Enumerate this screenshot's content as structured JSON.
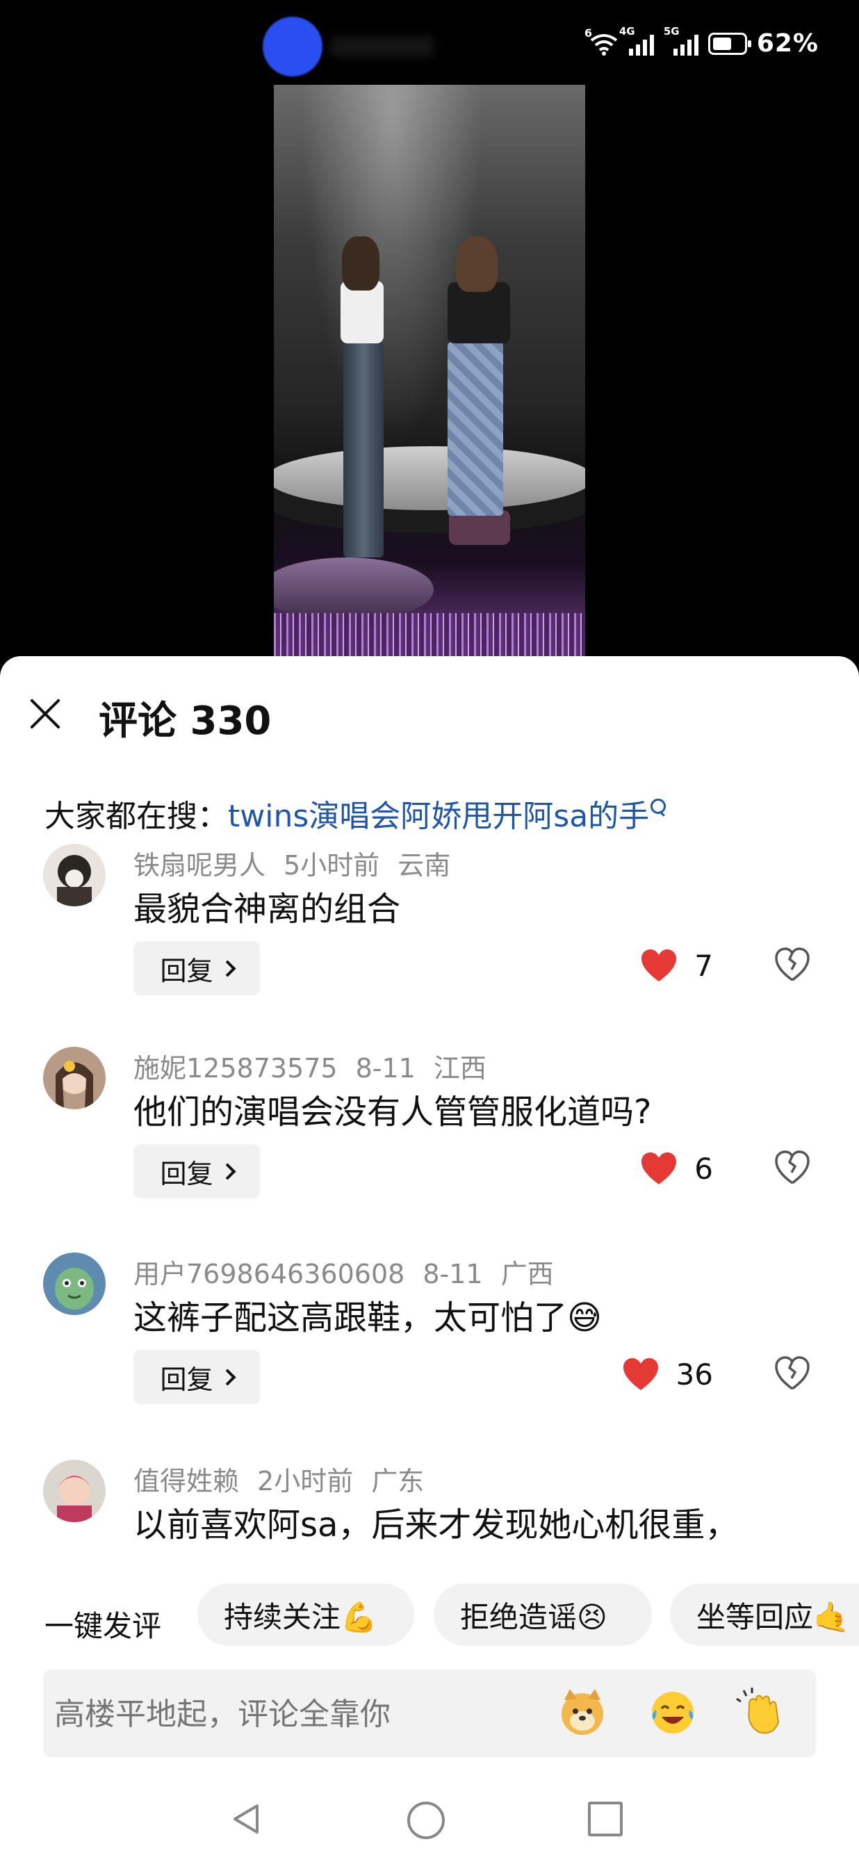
{
  "status_bar": {
    "wifi_badge": "6",
    "sim1_badge": "4G",
    "sim2_badge": "5G",
    "battery_percent": "62%",
    "battery_level": 0.62
  },
  "comments_panel": {
    "title": "评论 330",
    "hot_search_label": "大家都在搜：",
    "hot_search_query": "twins演唱会阿娇甩开阿sa的手",
    "reply_label": "回复",
    "comments": [
      {
        "user": "铁扇呢男人",
        "time": "5小时前",
        "location": "云南",
        "text": "最貌合神离的组合",
        "likes": "7"
      },
      {
        "user": "施妮125873575",
        "time": "8-11",
        "location": "江西",
        "text": "他们的演唱会没有人管管服化道吗?",
        "likes": "6"
      },
      {
        "user": "用户7698646360608",
        "time": "8-11",
        "location": "广西",
        "text": "这裤子配这高跟鞋，太可怕了😅",
        "likes": "36"
      },
      {
        "user": "值得姓赖",
        "time": "2小时前",
        "location": "广东",
        "text": "以前喜欢阿sa，后来才发现她心机很重，"
      }
    ]
  },
  "quick_replies": {
    "label": "一键发评",
    "chips": [
      "持续关注💪",
      "拒绝造谣😣",
      "坐等回应🤙"
    ]
  },
  "comment_input": {
    "placeholder": "高楼平地起，评论全靠你"
  },
  "emoji_shortcuts": [
    "doge-emoji",
    "laugh-cry-emoji",
    "clap-emoji"
  ],
  "colors": {
    "accent_link": "#1f56a8",
    "like_red": "#e53935",
    "chip_bg": "#f2f2f2"
  }
}
